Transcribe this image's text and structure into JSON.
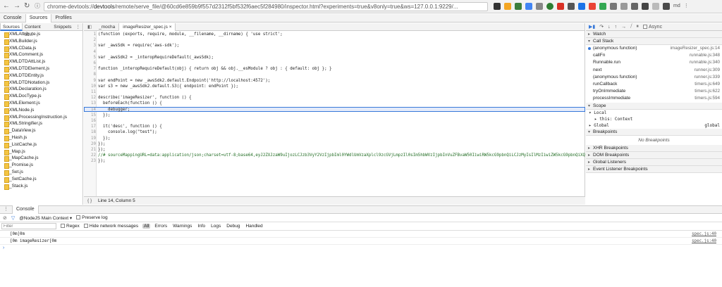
{
  "browser": {
    "url_prefix": "chrome-devtools://",
    "url_main": "devtools",
    "url_rest": "/remote/serve_file/@60cd6e859b9f557d2312f5bf532f6aec5f284980/inspector.html?experiments=true&v8only=true&ws=127.0.0.1:9229/...",
    "user_label": "md"
  },
  "top_tabs": [
    "Console",
    "Sources",
    "Profiles"
  ],
  "navigator": {
    "tabs": [
      "Sources",
      "Content sc...",
      "Snippets"
    ],
    "files": [
      "XMLAttribute.js",
      "XMLBuilder.js",
      "XMLCData.js",
      "XMLComment.js",
      "XMLDTDAttList.js",
      "XMLDTDElement.js",
      "XMLDTDEntity.js",
      "XMLDTDNotation.js",
      "XMLDeclaration.js",
      "XMLDocType.js",
      "XMLElement.js",
      "XMLNode.js",
      "XMLProcessingInstruction.js",
      "XMLStringifier.js",
      "_DataView.js",
      "_Hash.js",
      "_ListCache.js",
      "_Map.js",
      "_MapCache.js",
      "_Promise.js",
      "_Set.js",
      "_SetCache.js",
      "_Stack.js"
    ]
  },
  "editor": {
    "tabs": [
      "_mocha",
      "imageResizer_spec.js"
    ],
    "lines": [
      "(function (exports, require, module, __filename, __dirname) { 'use strict';",
      "",
      "var _awsSdk = require('aws-sdk');",
      "",
      "var _awsSdk2 = _interopRequireDefault(_awsSdk);",
      "",
      "function _interopRequireDefault(obj) { return obj && obj.__esModule ? obj : { default: obj }; }",
      "",
      "var endPoint = new _awsSdk2.default.Endpoint('http://localhost:4572');",
      "var s3 = new _awsSdk2.default.S3({ endpoint: endPoint });",
      "",
      "describe('imageResizer', function () {",
      "  beforeEach(function () {",
      "    debugger;",
      "  });",
      "",
      "  it('desc', function () {",
      "    console.log(\"test\");",
      "  });",
      "});",
      "});",
      "//# sourceMappingURL=data:application/json;charset=utf-8;base64,eyJ2ZXJzaW9uIjozLCJzb3VyY2VzIjpbIml0YWdlUmVzaXplcl9zcGVjLmpzIl0sIm5hbWVzIjpbInVuZFBvaW50IiwiRW5kcG9pbnQiLCJzMyIsIlMzIiwiZW5kcG9pbnQiXQ",
      "});"
    ],
    "current_line": 14,
    "status": "Line 14, Column 5",
    "format_icon": "{ }"
  },
  "debugger": {
    "async_label": "Async",
    "sections": {
      "watch": "Watch",
      "call_stack": "Call Stack",
      "scope": "Scope",
      "breakpoints": "Breakpoints",
      "xhr": "XHR Breakpoints",
      "dom": "DOM Breakpoints",
      "global_listeners": "Global Listeners",
      "event_listeners": "Event Listener Breakpoints"
    },
    "call_stack": [
      {
        "fn": "(anonymous function)",
        "loc": "imageResizer_spec.js:14"
      },
      {
        "fn": "callFn",
        "loc": "runnable.js:348"
      },
      {
        "fn": "Runnable.run",
        "loc": "runnable.js:340"
      },
      {
        "fn": "next",
        "loc": "runner.js:309"
      },
      {
        "fn": "(anonymous function)",
        "loc": "runner.js:339"
      },
      {
        "fn": "runCallback",
        "loc": "timers.js:649"
      },
      {
        "fn": "tryOnImmediate",
        "loc": "timers.js:622"
      },
      {
        "fn": "processImmediate",
        "loc": "timers.js:594"
      }
    ],
    "scope": {
      "local_label": "Local",
      "this_label": "this: Context",
      "global_label": "Global",
      "global_value": "global"
    },
    "no_breakpoints": "No Breakpoints"
  },
  "console": {
    "drawer_tab": "Console",
    "context": "@NodeJS Main Context",
    "preserve_log": "Preserve log",
    "filter_placeholder": "Filter",
    "regex": "Regex",
    "hide_network": "Hide network messages",
    "levels": [
      "All",
      "Errors",
      "Warnings",
      "Info",
      "Logs",
      "Debug",
      "Handled"
    ],
    "messages": [
      {
        "text": "[0m[0m",
        "src": "spec.js:40"
      },
      {
        "text": "[0m  imageResizer[0m",
        "src": "spec.js:40"
      }
    ],
    "prompt": "›"
  }
}
